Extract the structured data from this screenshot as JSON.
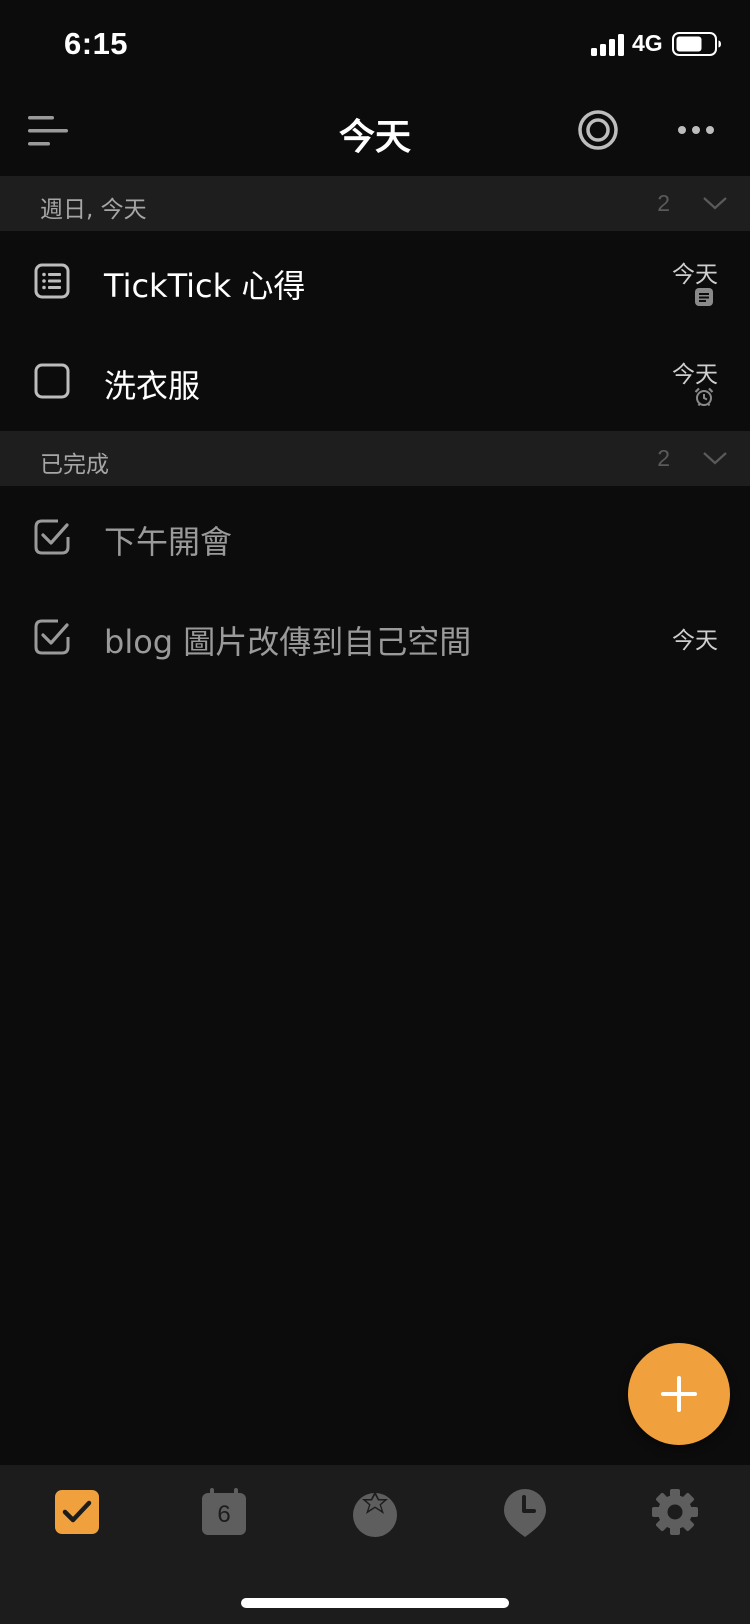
{
  "status_bar": {
    "time": "6:15",
    "network": "4G"
  },
  "header": {
    "title": "今天"
  },
  "sections": [
    {
      "label": "週日, 今天",
      "count": "2"
    },
    {
      "label": "已完成",
      "count": "2"
    }
  ],
  "tasks": [
    {
      "title": "TickTick 心得",
      "date": "今天",
      "icon": "note-list-icon",
      "sub_icon": "note-icon"
    },
    {
      "title": "洗衣服",
      "date": "今天",
      "icon": "checkbox-icon",
      "sub_icon": "alarm-icon"
    }
  ],
  "completed": [
    {
      "title": "下午開會",
      "date": "",
      "icon": "checked-checkbox-icon"
    },
    {
      "title": "blog 圖片改傳到自己空間",
      "date": "今天",
      "icon": "checked-checkbox-icon"
    }
  ],
  "tab_bar": {
    "calendar_day": "6",
    "active_tab": "tasks",
    "tabs": [
      "tasks",
      "calendar",
      "habits",
      "pomodoro",
      "settings"
    ]
  },
  "colors": {
    "accent": "#f0a03d",
    "background": "#0c0c0c",
    "section": "#1e1e1e",
    "tabbar": "#1c1c1c"
  }
}
